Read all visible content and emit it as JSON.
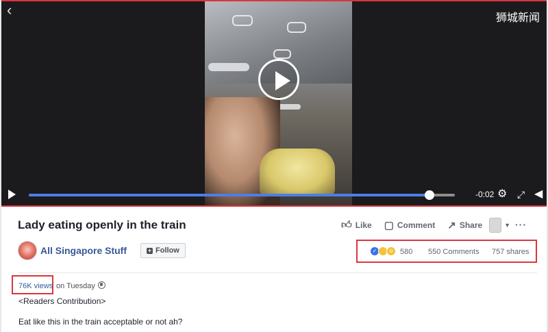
{
  "video": {
    "watermark": "狮城新闻",
    "time_remaining": "-0:02",
    "progress": 0.94,
    "icons": [
      "back-arrow-icon",
      "play-icon",
      "settings-icon",
      "fullscreen-icon",
      "volume-icon"
    ]
  },
  "post": {
    "title": "Lady eating openly in the train",
    "page_name": "All Singapore Stuff",
    "follow_label": "Follow",
    "actions": {
      "like": "Like",
      "comment": "Comment",
      "share": "Share"
    },
    "stats": {
      "reactions": "580",
      "comments": "550 Comments",
      "shares": "757 shares"
    },
    "views": "76K views",
    "posted": "on Tuesday",
    "description": [
      "<Readers Contribution>",
      "Eat like this in the train acceptable or not ah?"
    ]
  },
  "colors": {
    "accent": "#4a7fe8",
    "highlight": "#d9363e",
    "link": "#365899"
  }
}
